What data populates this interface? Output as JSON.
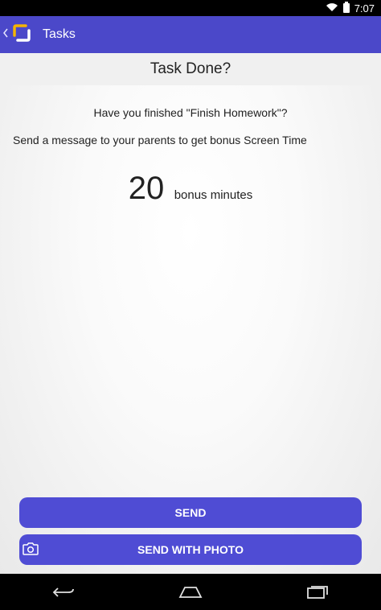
{
  "status": {
    "time": "7:07"
  },
  "appbar": {
    "title": "Tasks"
  },
  "header": {
    "title": "Task Done?"
  },
  "main": {
    "question": "Have you finished \"Finish Homework\"?",
    "prompt": "Send a message to your parents to get bonus Screen Time",
    "bonus_value": "20",
    "bonus_label": "bonus minutes"
  },
  "buttons": {
    "send": "SEND",
    "send_with_photo": "SEND WITH PHOTO"
  },
  "colors": {
    "appbar": "#4b48c9",
    "button": "#4f4cd4",
    "logo": "#f5b400"
  },
  "icons": {
    "back": "chevron-left-icon",
    "logo": "app-logo-icon",
    "camera": "camera-icon",
    "nav_back": "nav-back-icon",
    "nav_home": "nav-home-icon",
    "nav_recents": "nav-recents-icon"
  }
}
